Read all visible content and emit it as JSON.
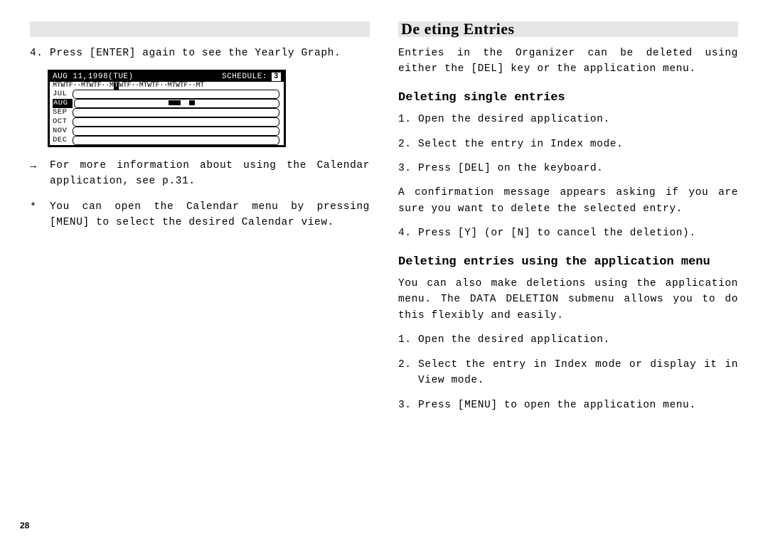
{
  "page_number": "28",
  "left": {
    "step4_marker": "4.",
    "step4_text": "Press [ENTER] again to see the Yearly Graph.",
    "lcd": {
      "date": "AUG 11,1998(TUE)",
      "sched_label": "SCHEDULE:",
      "sched_count": "3",
      "day_pattern_a": "MTWTF··MTWTF··M",
      "day_cursor": "T",
      "day_pattern_b": "WTF··MTWTF··MTWTF··MT",
      "months": [
        "JUL",
        "AUG",
        "SEP",
        "OCT",
        "NOV",
        "DEC"
      ]
    },
    "note1_marker": "→",
    "note1_text": "For more information about using the Calendar application, see p.31.",
    "note2_marker": "*",
    "note2_text": "You can open the Calendar menu by pressing [MENU] to select the desired Calendar view."
  },
  "right": {
    "section_title": "De eting Entries",
    "intro": "Entries in the Organizer can be deleted using either the [DEL] key or the application menu.",
    "sub1": "Deleting single entries",
    "s1_1m": "1.",
    "s1_1": "Open the desired application.",
    "s1_2m": "2.",
    "s1_2": "Select the entry in Index mode.",
    "s1_3m": "3.",
    "s1_3": "Press [DEL] on the keyboard.",
    "s1_conf": "A confirmation message appears asking if you are sure you want to delete the selected entry.",
    "s1_4m": "4.",
    "s1_4": "Press [Y] (or [N] to cancel the deletion).",
    "sub2": "Deleting entries using the application menu",
    "s2_intro": "You can also make deletions using the application menu. The DATA DELETION submenu allows you to do this flexibly and easily.",
    "s2_1m": "1.",
    "s2_1": "Open the desired application.",
    "s2_2m": "2.",
    "s2_2": "Select the entry in Index mode or display it in View mode.",
    "s2_3m": "3.",
    "s2_3": "Press [MENU] to open the application menu."
  }
}
